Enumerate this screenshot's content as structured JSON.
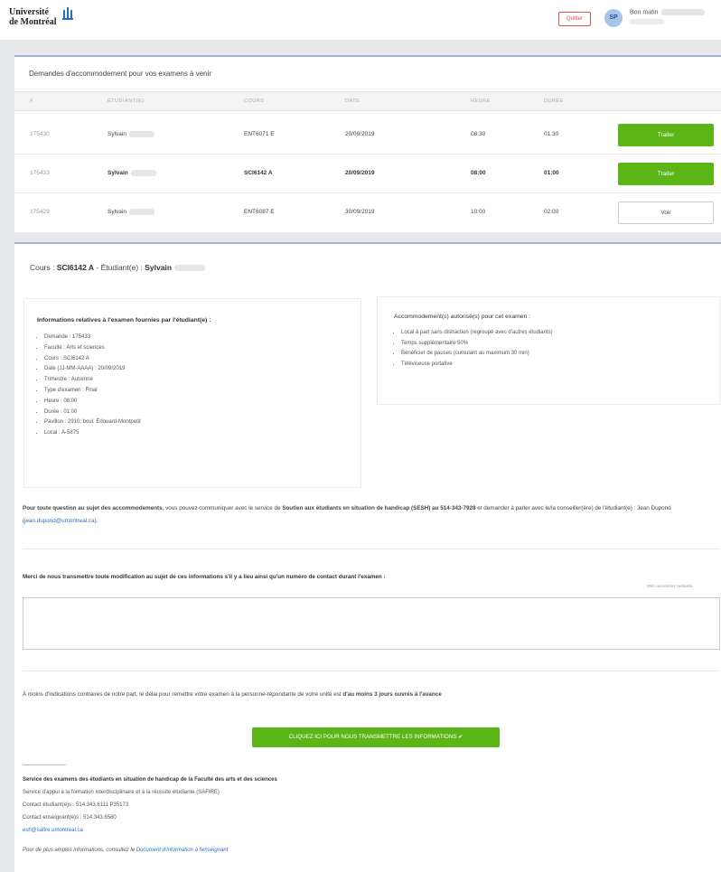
{
  "header": {
    "logo_line1": "Université",
    "logo_line2": "de Montréal",
    "quit_label": "Quitter",
    "avatar_initials": "SP",
    "greeting": "Bon matin"
  },
  "requests": {
    "title": "Demandes d'accommodement pour vos examens à venir",
    "columns": [
      "#",
      "ÉTUDIANT(E)",
      "COURS",
      "DATE",
      "HEURE",
      "DURÉE"
    ],
    "rows": [
      {
        "id": "175430",
        "student": "Sylvain",
        "course": "ENT6071 E",
        "date": "20/09/2019",
        "time": "08:30",
        "duration": "01:30",
        "action": "Traiter",
        "bold": false
      },
      {
        "id": "175433",
        "student": "Sylvain",
        "course": "SCI6142 A",
        "date": "20/09/2019",
        "time": "08:00",
        "duration": "01:00",
        "action": "Traiter",
        "bold": true
      },
      {
        "id": "175429",
        "student": "Sylvain",
        "course": "ENT6087 E",
        "date": "30/09/2019",
        "time": "10:00",
        "duration": "02:00",
        "action": "Voir",
        "bold": false
      }
    ]
  },
  "details": {
    "course_prefix": "Cours : ",
    "course_code": "SCI6142 A",
    "student_prefix": " - Étudiant(e) : ",
    "student_name": "Sylvain",
    "exam_info_title": "Informations relatives à l'examen fournies par l'étudiant(e) :",
    "exam_info": [
      "Demande : 175433",
      "Faculté : Arts et sciences",
      "Cours : SCI6142 A",
      "Date (JJ-MM-AAAA) : 20/09/2019",
      "Trimestre : Automne",
      "Type d'examen : Final",
      "Heure : 08:00",
      "Durée : 01:00",
      "Pavillon : 2910, boul. Édouard-Montpetit",
      "Local : A-5875"
    ],
    "accommodations_title": "Accommodement(s) autorisé(s) pour cet examen :",
    "accommodations": [
      "Local à part sans distraction (regroupé avec d'autres étudiants)",
      "Temps supplémentaire 50%",
      "Bénéficier de pauses (cumulant au maximum 30 min)",
      "Téléviseuse portative"
    ],
    "contact_text_bold": "Pour toute question au sujet des accommodements",
    "contact_text": ", vous pouvez communiquer avec le service de ",
    "contact_service": "Soutien aux étudiants en situation de handicap (SESH) au 514-343-7928",
    "contact_text2": " et demander à parler avec le/la conseiller(ère) de l'étudiant(e) : Jean Dupond (",
    "contact_email": "jean.dupond@umontreal.ca",
    "contact_text3": ").",
    "merci_text": "Merci de nous transmettre toute modification au sujet de ces informations s'il y a lieu ainsi qu'un numéro de contact durant l'examen :",
    "chars_left": "250 caractères restants",
    "delay_text": "À moins d'indications contraires de notre part, le délai pour remettre votre examen à la personne-répondante de votre unité est ",
    "delay_bold": "d'au moins 3 jours ouvrés à l'avance",
    "submit_label": "CLIQUEZ ICI POUR NOUS TRANSMETTRE LES INFORMATIONS ✔",
    "footer_service": "Service des examens des étudiants en situation de handicap de la Faculté des arts et des sciences",
    "footer_line1": "Service d'appui à la formation interdisciplinaire et à la réussite étudiante (SAFIRE)",
    "footer_line2": "Contact étudiant(e)s : 514.343.6111 P35173",
    "footer_line3": "Contact enseignant(e)s : 514.343.6580",
    "footer_email": "esh@safire.umontreal.ca",
    "footer_note_prefix": "Pour de plus amples informations, consultez le ",
    "footer_note_link": "Document d'information à l'enseignant"
  }
}
